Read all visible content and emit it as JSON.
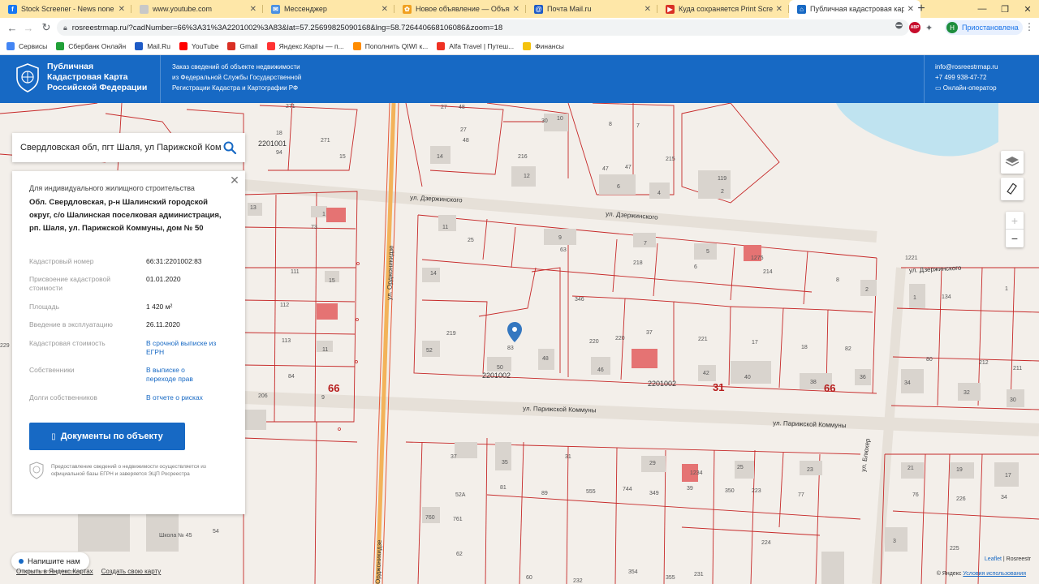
{
  "browser": {
    "tabs": [
      {
        "title": "Stock Screener - News none usa",
        "color": "#1877f2",
        "glyph": "f"
      },
      {
        "title": "www.youtube.com",
        "color": "#c8c8c8",
        "glyph": ""
      },
      {
        "title": "Мессенджер",
        "color": "#4a90e2",
        "glyph": "✉"
      },
      {
        "title": "Новое объявление — Объявле",
        "color": "#f0a020",
        "glyph": "✿"
      },
      {
        "title": "Почта Mail.ru",
        "color": "#1e5bc6",
        "glyph": "@"
      },
      {
        "title": "Куда сохраняется Print Screen",
        "color": "#d93025",
        "glyph": "▶"
      },
      {
        "title": "Публичная кадастровая карта",
        "color": "#1769c4",
        "glyph": "⌂"
      }
    ],
    "active_tab_index": 6,
    "url": "rosreestrmap.ru/?cadNumber=66%3A31%3A2201002%3A83&lat=57.25699825090168&lng=58.726440668106086&zoom=18",
    "profile_label": "Приостановлена",
    "profile_initial": "Н",
    "abp_label": "ABP",
    "bookmarks": [
      {
        "label": "Сервисы",
        "color": "#4285f4"
      },
      {
        "label": "Сбербанк Онлайн",
        "color": "#21a038"
      },
      {
        "label": "Mail.Ru",
        "color": "#1e5bc6"
      },
      {
        "label": "YouTube",
        "color": "#ff0000"
      },
      {
        "label": "Gmail",
        "color": "#d93025"
      },
      {
        "label": "Яндекс.Карты — п...",
        "color": "#ff3333"
      },
      {
        "label": "Пополнить QIWI к...",
        "color": "#ff8c00"
      },
      {
        "label": "Alfa Travel | Путеш...",
        "color": "#ef3124"
      },
      {
        "label": "Финансы",
        "color": "#f4c20d"
      }
    ]
  },
  "site": {
    "title_lines": [
      "Публичная",
      "Кадастровая Карта",
      "Российской Федерации"
    ],
    "description_lines": [
      "Заказ сведений об объекте недвижимости",
      "из Федеральной Службы Государственной",
      "Регистрации Кадастра и Картографии РФ"
    ],
    "contacts": {
      "email": "info@rosreestrmap.ru",
      "phone": "+7 499 938-47-72",
      "operator": "Онлайн-оператор"
    },
    "brand_color": "#1769c4"
  },
  "search": {
    "value": "Свердловская обл, пгт Шаля, ул Парижской Комм"
  },
  "object": {
    "type": "Для индивидуального жилищного строительства",
    "address": "Обл. Свердловская, р-н Шалинский городской округ, с/о Шалинская поселковая администрация, рп. Шаля, ул. Парижской Коммуны, дом № 50",
    "rows": [
      {
        "key": "Кадастровый номер",
        "value": "66:31:2201002:83",
        "link": false
      },
      {
        "key": "Присвоение кадастровой стоимости",
        "value": "01.01.2020",
        "link": false
      },
      {
        "key": "Площадь",
        "value": "1 420 м²",
        "link": false
      },
      {
        "key": "Введение в эксплуатацию",
        "value": "26.11.2020",
        "link": false
      },
      {
        "key": "Кадастровая стоимость",
        "value": "В срочной выписке из ЕГРН",
        "link": true
      },
      {
        "key": "Собственники",
        "value": "В выписке о переходе прав",
        "link": true
      },
      {
        "key": "Долги собственников",
        "value": "В отчете о рисках",
        "link": true
      }
    ],
    "documents_button": "Документы по объекту",
    "note": "Предоставление сведений о недвижимости осуществляется из официальной базы ЕГРН и заверяется ЭЦП Росреестра"
  },
  "map": {
    "zoom_in": "+",
    "zoom_out": "−",
    "streets": {
      "dzerzhinskogo_1": "ул. Дзержинского",
      "dzerzhinskogo_2": "ул. Дзержинского",
      "dzerzhinskogo_3": "ул. Дзержинского",
      "ordzhonikidze": "ул. Орджоникидзе",
      "ordzhonikidze_2": "Орджоникидзе",
      "parizhskoy_1": "ул. Парижской Коммуны",
      "parizhskoy_2": "ул. Парижской Коммуны",
      "blyukher": "ул. Блюхер",
      "school": "Школа № 45"
    },
    "quarters": {
      "q1": "2201001",
      "q2": "2201002",
      "q3": "2201002",
      "big1": "66",
      "big2": "31",
      "big3": "66"
    },
    "chat_label": "Напишите нам",
    "yandex_open": "Открыть в Яндекс.Картах",
    "yandex_create": "Создать свою карту",
    "attribution_leaflet": "Leaflet",
    "attribution_rosreestr": "Rosreestr",
    "attribution_yandex_prefix": "© Яндекс",
    "attribution_yandex_link": "Условия использования"
  }
}
